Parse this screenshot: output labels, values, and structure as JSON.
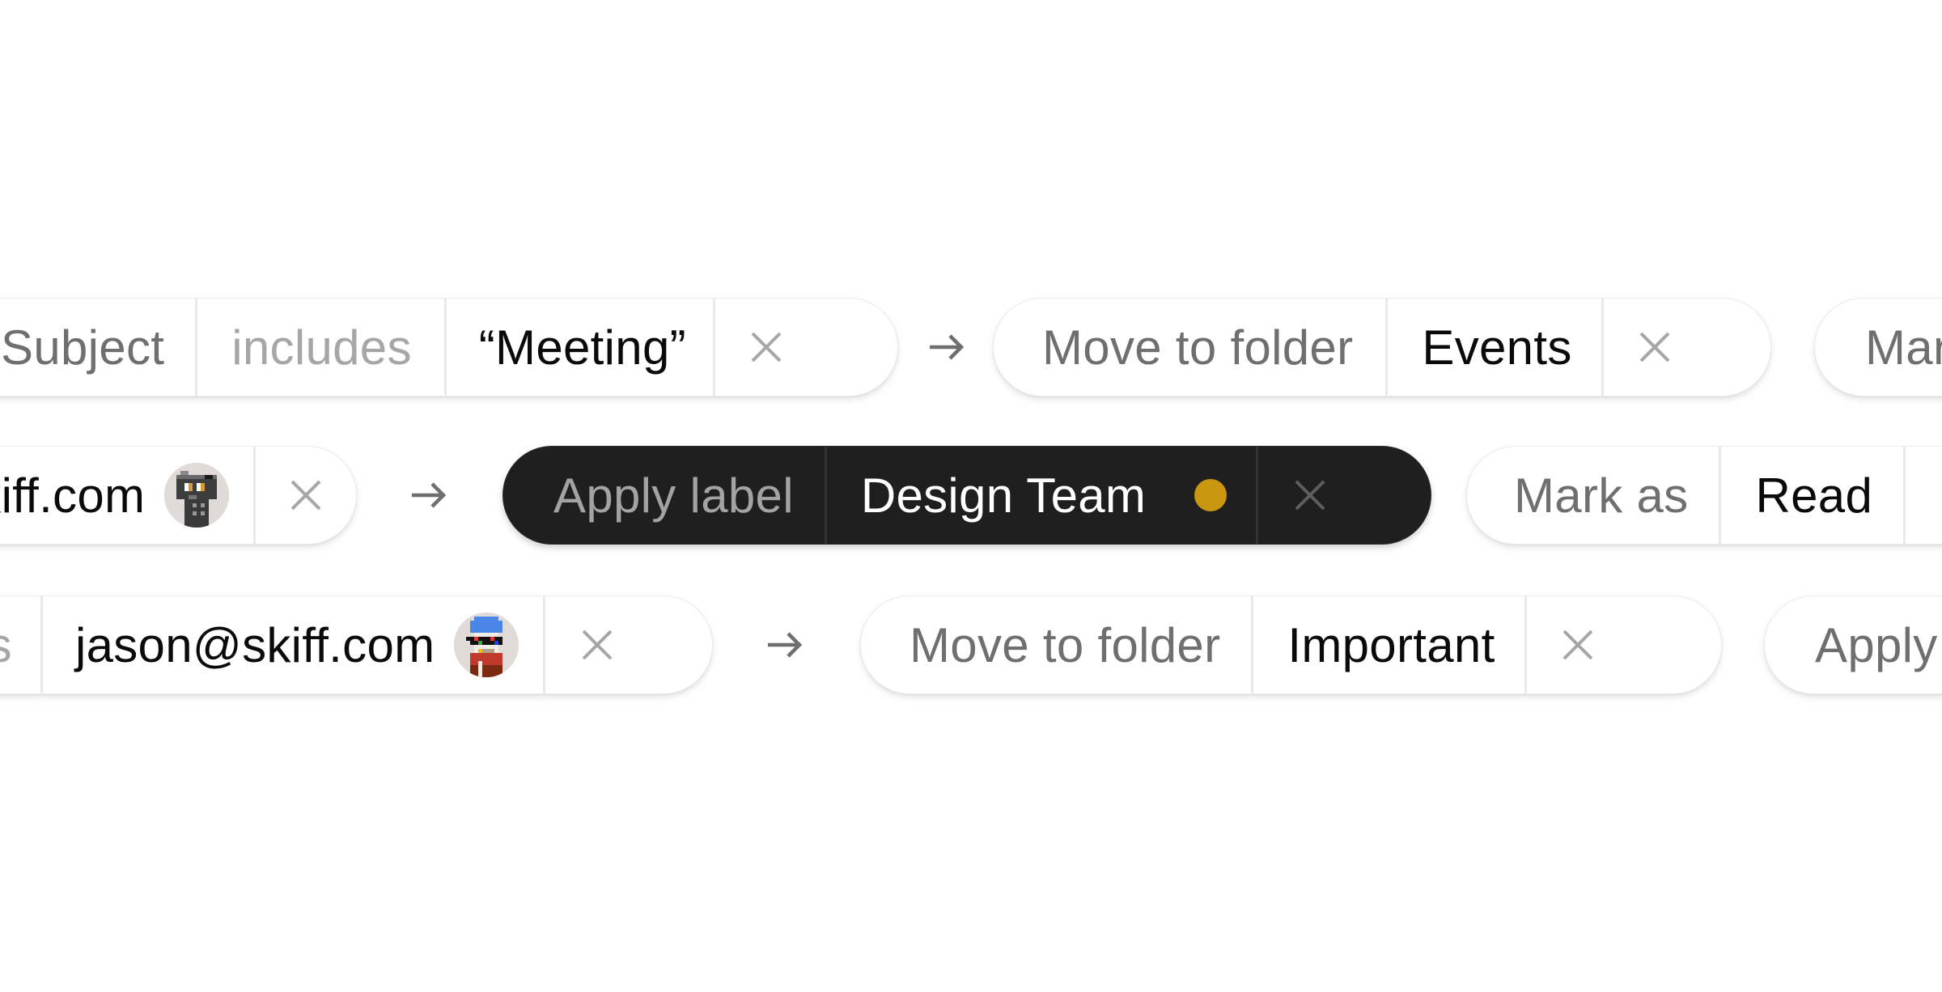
{
  "rows": [
    {
      "condition": {
        "field": "Subject",
        "operator": "includes",
        "value": "“Meeting”",
        "remove_icon": "close-icon"
      },
      "arrow_icon": "arrow-right-icon",
      "action": {
        "verb": "Move to folder",
        "target": "Events",
        "remove_icon": "close-icon"
      },
      "next_action": {
        "verb": "Mark as"
      }
    },
    {
      "condition": {
        "value": "skiff.com",
        "avatar": "pixel-avatar-camera",
        "remove_icon": "close-icon"
      },
      "arrow_icon": "arrow-right-icon",
      "action": {
        "verb": "Apply label",
        "target": "Design Team",
        "label_color": "#C9960F",
        "selected": true,
        "remove_icon": "close-icon"
      },
      "next_action": {
        "verb": "Mark as",
        "target": "Read"
      }
    },
    {
      "condition": {
        "operator": "is",
        "value": "jason@skiff.com",
        "avatar": "pixel-avatar-skull",
        "remove_icon": "close-icon"
      },
      "arrow_icon": "arrow-right-icon",
      "action": {
        "verb": "Move to folder",
        "target": "Important",
        "remove_icon": "close-icon"
      },
      "next_action": {
        "verb": "Apply label"
      }
    }
  ],
  "colors": {
    "field_text": "#6f6f6f",
    "operator_text": "#a6a6a6",
    "value_text": "#0a0a0a",
    "dark_pill_bg": "#1f1f1f",
    "label_dot": "#C9960F"
  }
}
